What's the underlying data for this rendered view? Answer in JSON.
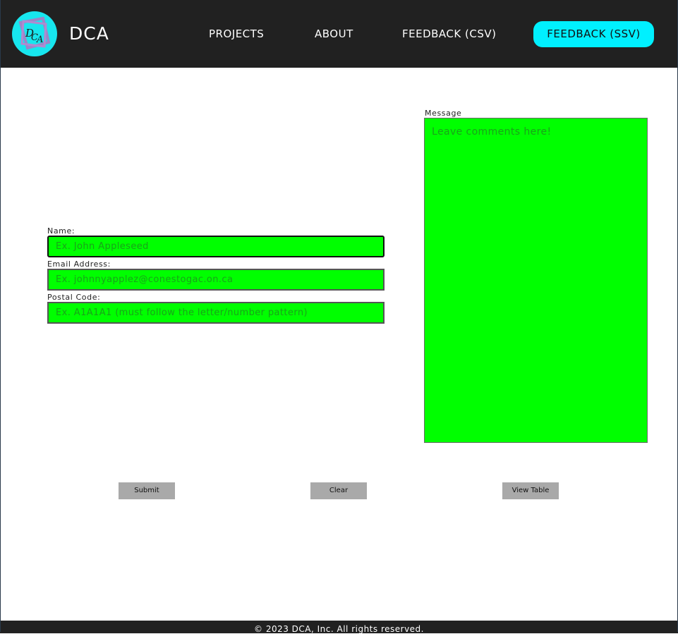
{
  "header": {
    "brand": "DCA",
    "nav": {
      "projects": "PROJECTS",
      "about": "ABOUT",
      "feedback_csv": "FEEDBACK (CSV)",
      "feedback_ssv": "FEEDBACK (SSV)"
    },
    "logo_text": "DCA",
    "logo_icon": "dca-logo-icon"
  },
  "form": {
    "name": {
      "label": "Name:",
      "placeholder": "Ex. John Appleseed",
      "value": ""
    },
    "email": {
      "label": "Email Address:",
      "placeholder": "Ex. johnnyapplez@conestogac.on.ca",
      "value": ""
    },
    "postal": {
      "label": "Postal Code:",
      "placeholder": "Ex. A1A1A1 (must follow the letter/number pattern)",
      "value": ""
    },
    "message": {
      "label": "Message",
      "placeholder": "Leave comments here!",
      "value": ""
    }
  },
  "buttons": {
    "submit": "Submit",
    "clear": "Clear",
    "view_table": "View Table"
  },
  "footer": {
    "copyright": "© 2023 DCA, Inc. All rights reserved."
  },
  "colors": {
    "header_bg": "#212121",
    "accent_cyan": "#00f0ff",
    "field_green": "#00ff00",
    "button_gray": "#a9a9a9"
  }
}
